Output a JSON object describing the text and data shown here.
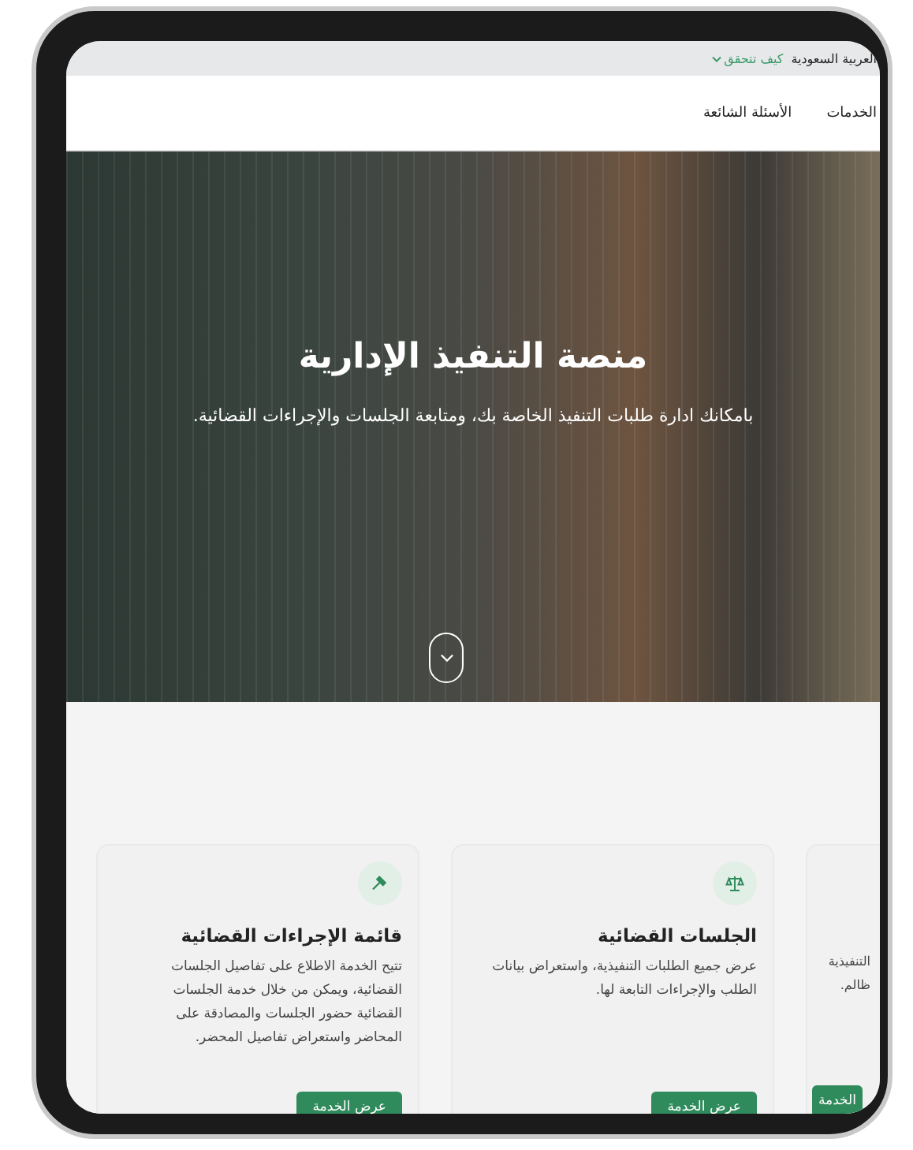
{
  "top_bar": {
    "region": "العربية السعودية",
    "verify_link": "كيف تتحقق"
  },
  "nav": {
    "items": [
      {
        "label": "الخدمات"
      },
      {
        "label": "الأسئلة الشائعة"
      }
    ]
  },
  "hero": {
    "title": "منصة التنفيذ الإدارية",
    "subtitle": "بامكانك ادارة طلبات التنفيذ الخاصة بك، ومتابعة الجلسات والإجراءات القضائية."
  },
  "cards": [
    {
      "kind": "partial",
      "lines": [
        "التنفيذية",
        "ظالم."
      ],
      "button": "الخدمة"
    },
    {
      "kind": "scales",
      "title": "الجلسات القضائية",
      "lines": [
        "عرض جميع الطلبات التنفيذية، واستعراض بيانات",
        "الطلب والإجراءات التابعة لها."
      ],
      "button": "عرض الخدمة"
    },
    {
      "kind": "gavel",
      "title": "قائمة الإجراءات القضائية",
      "lines": [
        "تتيح الخدمة الاطلاع على تفاصيل الجلسات",
        "القضائية، ويمكن من خلال خدمة الجلسات",
        "القضائية حضور الجلسات والمصادقة على",
        "المحاضر واستعراض تفاصيل المحضر."
      ],
      "button": "عرض الخدمة"
    }
  ]
}
